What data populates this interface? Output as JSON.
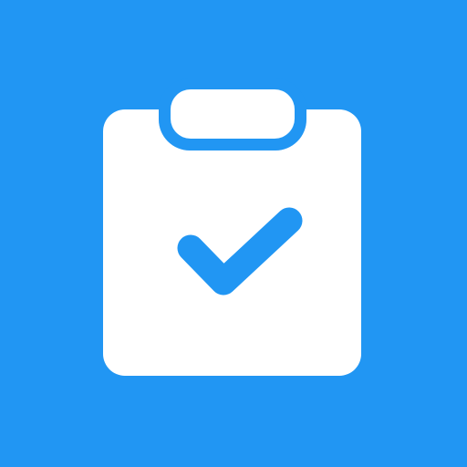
{
  "icon": {
    "name": "clipboard-check-icon",
    "colors": {
      "background": "#2196F3",
      "foreground": "#FFFFFF",
      "accent": "#2196F3"
    }
  }
}
